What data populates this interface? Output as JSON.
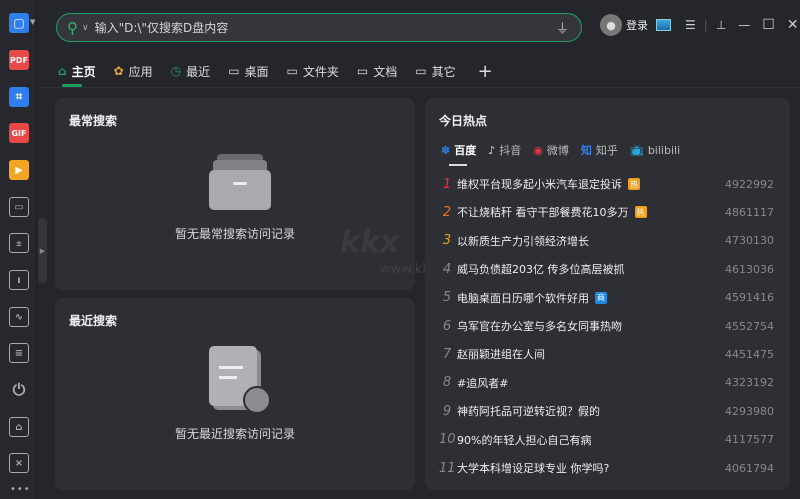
{
  "search": {
    "placeholder": "输入\"D:\\\"仅搜索D盘内容"
  },
  "account": {
    "login": "登录"
  },
  "tabs": [
    {
      "label": "主页",
      "icon": "home-icon"
    },
    {
      "label": "应用",
      "icon": "apps-icon"
    },
    {
      "label": "最近",
      "icon": "clock-icon"
    },
    {
      "label": "桌面",
      "icon": "monitor-icon"
    },
    {
      "label": "文件夹",
      "icon": "monitor-icon"
    },
    {
      "label": "文档",
      "icon": "monitor-icon"
    },
    {
      "label": "其它",
      "icon": "monitor-icon"
    },
    {
      "label": "+"
    }
  ],
  "frequent": {
    "title": "最常搜索",
    "empty": "暂无最常搜索访问记录"
  },
  "recent": {
    "title": "最近搜索",
    "empty": "暂无最近搜索访问记录"
  },
  "hot": {
    "title": "今日热点",
    "sources": [
      "百度",
      "抖音",
      "微博",
      "知乎",
      "bilibili"
    ],
    "items": [
      {
        "rank": "1",
        "title": "维权平台现多起小米汽车退定投诉",
        "badge": "热",
        "badge_color": "#f0a020",
        "count": "4922992",
        "rank_color": "#e8344a"
      },
      {
        "rank": "2",
        "title": "不让烧秸秆 看守干部餐费花10多万",
        "badge": "热",
        "badge_color": "#f0a020",
        "count": "4861117",
        "rank_color": "#f26b1d"
      },
      {
        "rank": "3",
        "title": "以新质生产力引领经济增长",
        "count": "4730130",
        "rank_color": "#e8a21e"
      },
      {
        "rank": "4",
        "title": "威马负债超203亿 传多位高层被抓",
        "count": "4613036"
      },
      {
        "rank": "5",
        "title": "电脑桌面日历哪个软件好用",
        "badge": "商",
        "badge_color": "#1e88e5",
        "count": "4591416"
      },
      {
        "rank": "6",
        "title": "乌军官在办公室与多名女同事热吻",
        "count": "4552754"
      },
      {
        "rank": "7",
        "title": "赵丽颖进组在人间",
        "count": "4451475"
      },
      {
        "rank": "8",
        "title": "#追风者#",
        "count": "4323192"
      },
      {
        "rank": "9",
        "title": "神药阿托品可逆转近视？假的",
        "count": "4293980"
      },
      {
        "rank": "10",
        "title": "90%的年轻人担心自己有病",
        "count": "4117577"
      },
      {
        "rank": "11",
        "title": "大学本科增设足球专业 你学吗?",
        "count": "4061794"
      }
    ]
  },
  "sidebar": [
    "screenshot-icon",
    "pdf-icon",
    "ocr-icon",
    "gif-icon",
    "video-icon",
    "monitor-icon",
    "calculator-icon",
    "lock-icon",
    "monitor-wave-icon",
    "notepad-icon",
    "power-icon",
    "cleaner-icon",
    "trash-icon",
    "more-icon"
  ],
  "sidebar_labels": {
    "pdf": "PDF",
    "gif": "GIF"
  },
  "watermark": {
    "text": "kkx",
    "url": "www.kkx.net"
  },
  "accent": "#1f9d63"
}
